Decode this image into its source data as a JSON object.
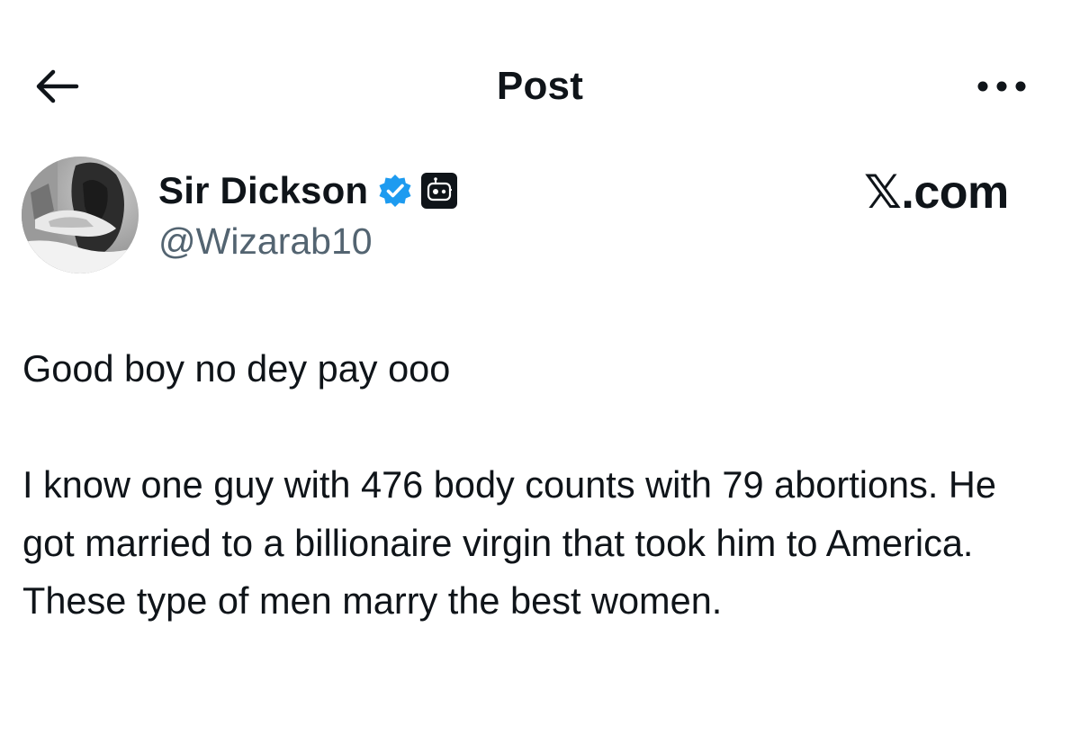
{
  "header": {
    "title": "Post",
    "back_icon": "arrow-left-icon",
    "more_icon": "more-horizontal-icon"
  },
  "author": {
    "name": "Sir Dickson",
    "handle": "@Wizarab10",
    "verified_icon": "verified-badge-icon",
    "verified_color": "#1d9bf0",
    "affiliate_icon": "robot-badge-icon"
  },
  "watermark": {
    "text": "𝕏.com"
  },
  "post": {
    "paragraphs": [
      "Good boy no dey pay ooo",
      "I know one guy with 476 body counts with 79 abortions. He got married to a billionaire virgin that took him to America. These type of men marry the best women."
    ]
  },
  "colors": {
    "text_primary": "#0f1419",
    "text_secondary": "#536471",
    "background": "#ffffff"
  }
}
